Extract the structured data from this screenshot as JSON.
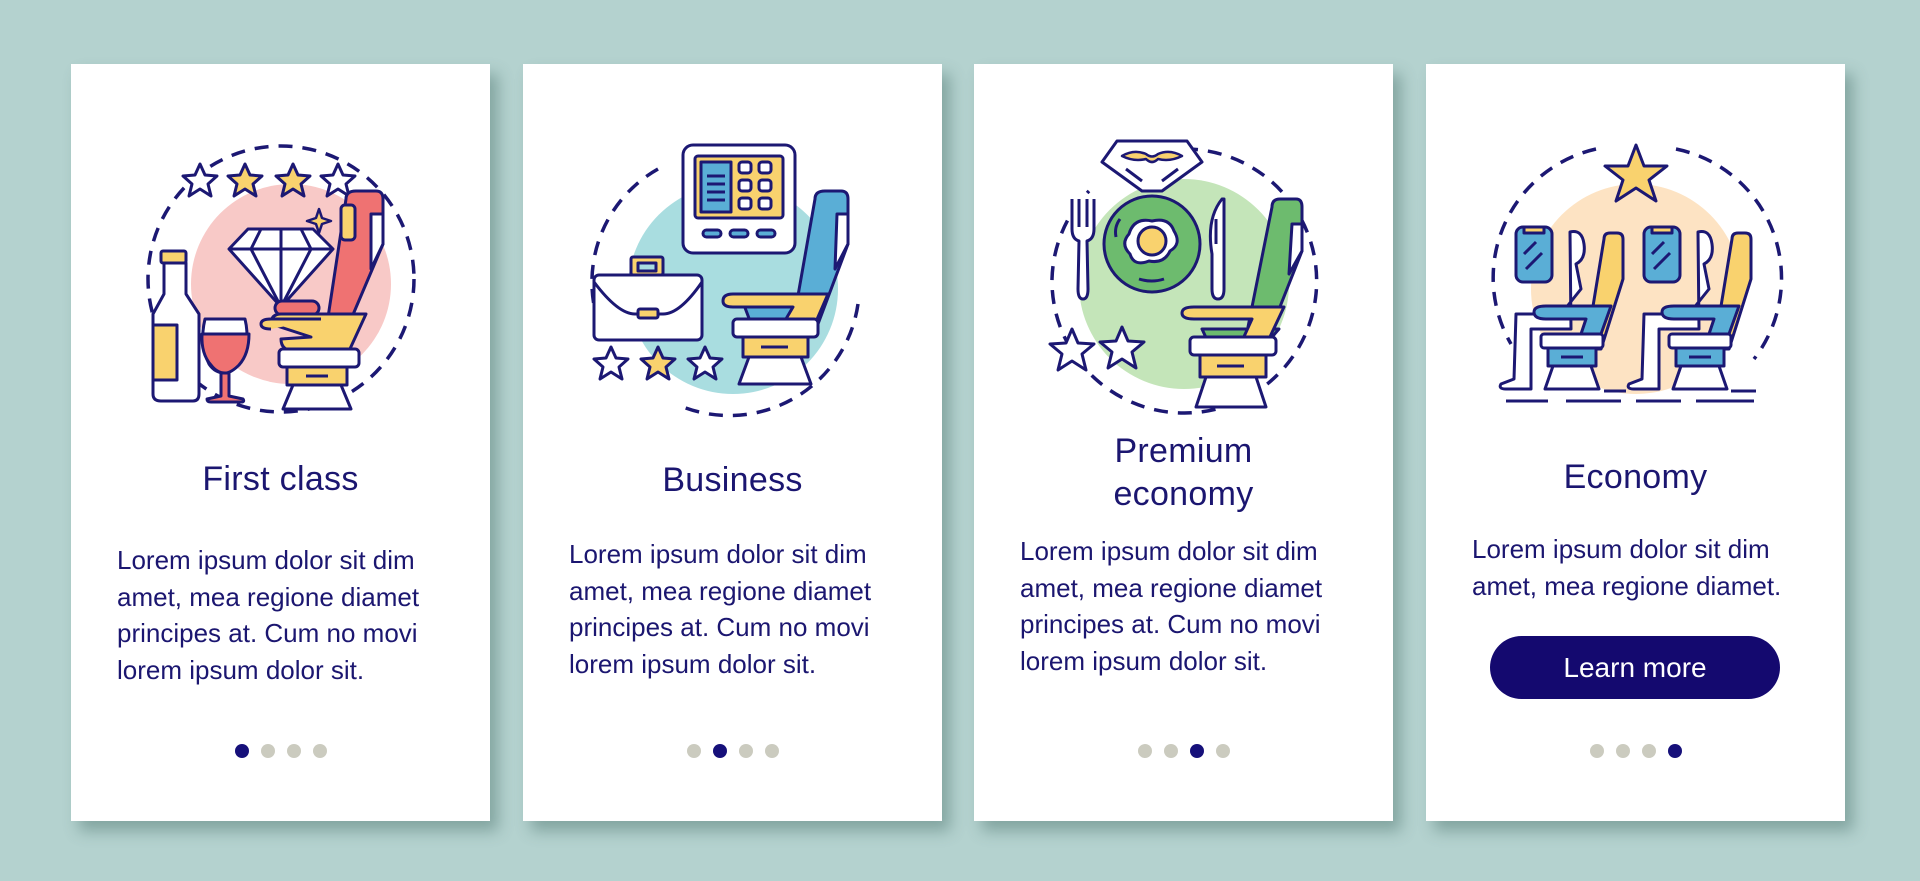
{
  "colors": {
    "background": "#b4d2cf",
    "card": "#ffffff",
    "text": "#1b1670",
    "stroke": "#1c1873",
    "dot_active": "#16107a",
    "dot_inactive": "#cbcbbf",
    "button": "#14096f",
    "yellow": "#f9d26e"
  },
  "cards": [
    {
      "title": [
        "First class"
      ],
      "body": [
        "Lorem ipsum dolor sit dim",
        "amet, mea regione diamet",
        "principes at. Cum no movi",
        "lorem ipsum dolor sit."
      ],
      "icon": "first-class-icon",
      "accent_bg": "#f8c9c7",
      "accent": "#ef7272",
      "active_page": 1,
      "total_pages": 4
    },
    {
      "title": [
        "Business"
      ],
      "body": [
        "Lorem ipsum dolor sit dim",
        "amet, mea regione diamet",
        "principes at. Cum no movi",
        "lorem ipsum dolor sit."
      ],
      "icon": "business-class-icon",
      "accent_bg": "#a9dde0",
      "accent": "#5aaed6",
      "active_page": 2,
      "total_pages": 4
    },
    {
      "title": [
        "Premium",
        "economy"
      ],
      "body": [
        "Lorem ipsum dolor sit dim",
        "amet, mea regione diamet",
        "principes at. Cum no movi",
        "lorem ipsum dolor sit."
      ],
      "icon": "premium-economy-icon",
      "accent_bg": "#c4e5b9",
      "accent": "#6dbb6e",
      "active_page": 3,
      "total_pages": 4
    },
    {
      "title": [
        "Economy"
      ],
      "body": [
        "Lorem ipsum dolor sit dim",
        "amet, mea regione diamet."
      ],
      "icon": "economy-class-icon",
      "accent_bg": "#fde3c3",
      "accent": "#5aaed6",
      "button_label": "Learn more",
      "active_page": 4,
      "total_pages": 4
    }
  ]
}
